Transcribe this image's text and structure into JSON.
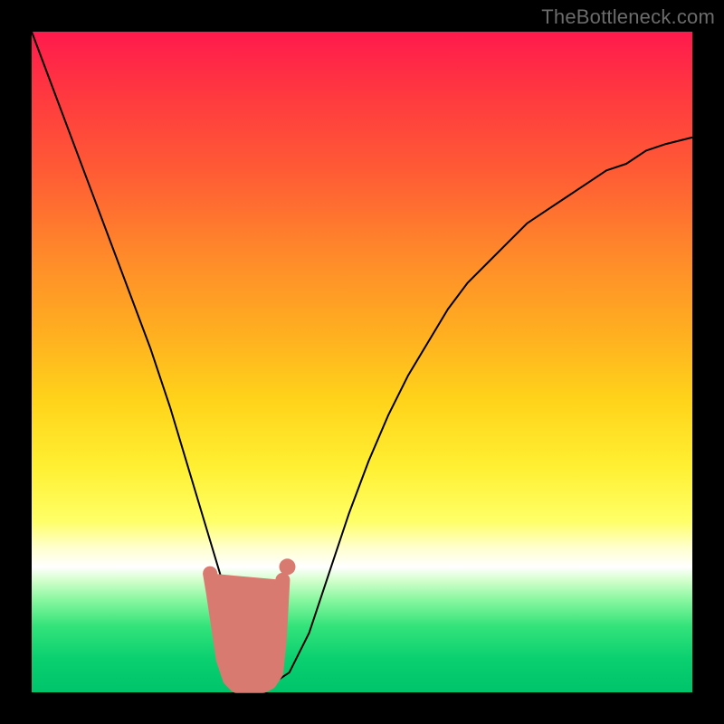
{
  "watermark": "TheBottleneck.com",
  "chart_data": {
    "type": "line",
    "title": "",
    "xlabel": "",
    "ylabel": "",
    "xlim": [
      0,
      100
    ],
    "ylim": [
      0,
      100
    ],
    "series": [
      {
        "name": "bottleneck-curve",
        "x": [
          0,
          3,
          6,
          9,
          12,
          15,
          18,
          21,
          24,
          27,
          30,
          33,
          36,
          39,
          42,
          45,
          48,
          51,
          54,
          57,
          60,
          63,
          66,
          69,
          72,
          75,
          78,
          81,
          84,
          87,
          90,
          93,
          96,
          100
        ],
        "values": [
          100,
          92,
          84,
          76,
          68,
          60,
          52,
          43,
          33,
          23,
          13,
          5,
          1,
          3,
          9,
          18,
          27,
          35,
          42,
          48,
          53,
          58,
          62,
          65,
          68,
          71,
          73,
          75,
          77,
          79,
          80,
          82,
          83,
          84
        ]
      }
    ],
    "markers": {
      "name": "highlight-points",
      "x": [
        27,
        27.5,
        29,
        30,
        31,
        32,
        33,
        34,
        35,
        36,
        37,
        37.5,
        38
      ],
      "values": [
        18,
        15,
        5,
        2,
        1,
        1,
        1,
        1,
        1,
        1.5,
        3,
        8,
        17
      ]
    },
    "background_gradient": {
      "top": "#ff1a4d",
      "mid": "#fff033",
      "bottom": "#00c46a"
    }
  }
}
